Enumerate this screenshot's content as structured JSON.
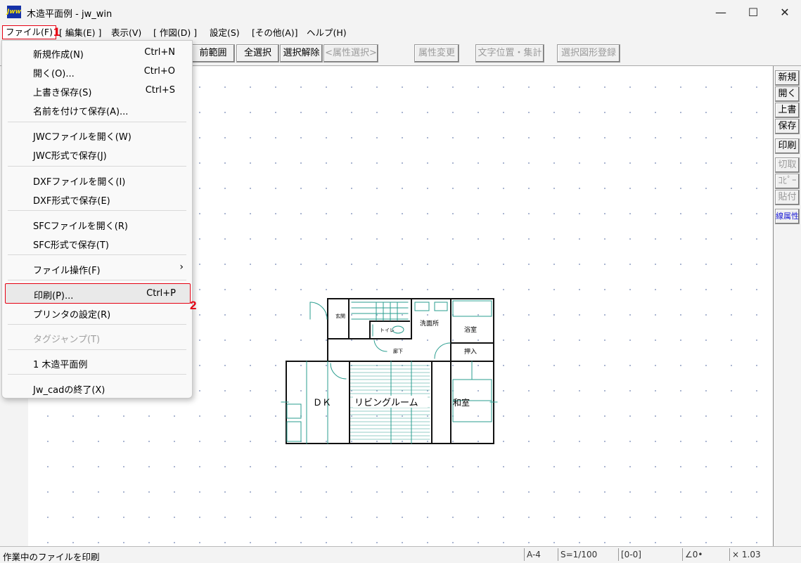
{
  "window": {
    "title": "木造平面例 - jw_win",
    "app_icon_text": "Jww",
    "controls": {
      "minimize": "—",
      "maximize": "☐",
      "close": "✕"
    }
  },
  "menubar": {
    "items": [
      "ファイル(F)",
      "[ 編集(E) ]",
      "表示(V)",
      "[ 作図(D) ]",
      "設定(S)",
      "[その他(A)]",
      "ヘルプ(H)"
    ]
  },
  "toolbar": {
    "buttons": [
      {
        "label": "前範囲",
        "enabled": true
      },
      {
        "label": "全選択",
        "enabled": true
      },
      {
        "label": "選択解除",
        "enabled": true
      },
      {
        "label": "<属性選択>",
        "enabled": false
      },
      {
        "label": "属性変更",
        "enabled": false
      },
      {
        "label": "文字位置・集計",
        "enabled": false
      },
      {
        "label": "選択図形登録",
        "enabled": false
      }
    ]
  },
  "right_panel": {
    "buttons": [
      {
        "label": "新規",
        "enabled": true
      },
      {
        "label": "開く",
        "enabled": true
      },
      {
        "label": "上書",
        "enabled": true
      },
      {
        "label": "保存",
        "enabled": true
      },
      {
        "label": "印刷",
        "enabled": true
      },
      {
        "label": "切取",
        "enabled": false
      },
      {
        "label": "ｺﾋﾟｰ",
        "enabled": false
      },
      {
        "label": "貼付",
        "enabled": false
      },
      {
        "label": "線属性",
        "enabled": true
      }
    ]
  },
  "file_menu": {
    "groups": [
      [
        {
          "label": "新規作成(N)",
          "shortcut": "Ctrl+N"
        },
        {
          "label": "開く(O)...",
          "shortcut": "Ctrl+O"
        },
        {
          "label": "上書き保存(S)",
          "shortcut": "Ctrl+S"
        },
        {
          "label": "名前を付けて保存(A)...",
          "shortcut": ""
        }
      ],
      [
        {
          "label": "JWCファイルを開く(W)",
          "shortcut": ""
        },
        {
          "label": "JWC形式で保存(J)",
          "shortcut": ""
        }
      ],
      [
        {
          "label": "DXFファイルを開く(I)",
          "shortcut": ""
        },
        {
          "label": "DXF形式で保存(E)",
          "shortcut": ""
        }
      ],
      [
        {
          "label": "SFCファイルを開く(R)",
          "shortcut": ""
        },
        {
          "label": "SFC形式で保存(T)",
          "shortcut": ""
        }
      ],
      [
        {
          "label": "ファイル操作(F)",
          "shortcut": "",
          "submenu": true
        }
      ],
      [
        {
          "label": "印刷(P)...",
          "shortcut": "Ctrl+P",
          "highlighted": true
        },
        {
          "label": "プリンタの設定(R)",
          "shortcut": ""
        }
      ],
      [
        {
          "label": "タグジャンプ(T)",
          "shortcut": "",
          "disabled": true
        }
      ],
      [
        {
          "label": "1 木造平面例",
          "shortcut": ""
        }
      ],
      [
        {
          "label": "Jw_cadの終了(X)",
          "shortcut": ""
        }
      ]
    ],
    "submenu_arrow": "›"
  },
  "annotations": {
    "step1": "1",
    "step2": "2",
    "highlight_color": "#e60012"
  },
  "floor_plan": {
    "rooms": {
      "dk": "ＤＫ",
      "living": "リビングルーム",
      "washitsu": "和室",
      "senmenjo": "洗面所",
      "yokushitsu": "浴室",
      "oshiire": "押入",
      "roka": "廊下",
      "toilet": "トイレ",
      "genkan": "玄関"
    }
  },
  "statusbar": {
    "message": "作業中のファイルを印刷",
    "paper": "A-4",
    "scale": "S=1/100",
    "layer": "[0-0]",
    "angle": "∠0•",
    "zoom": "× 1.03"
  }
}
